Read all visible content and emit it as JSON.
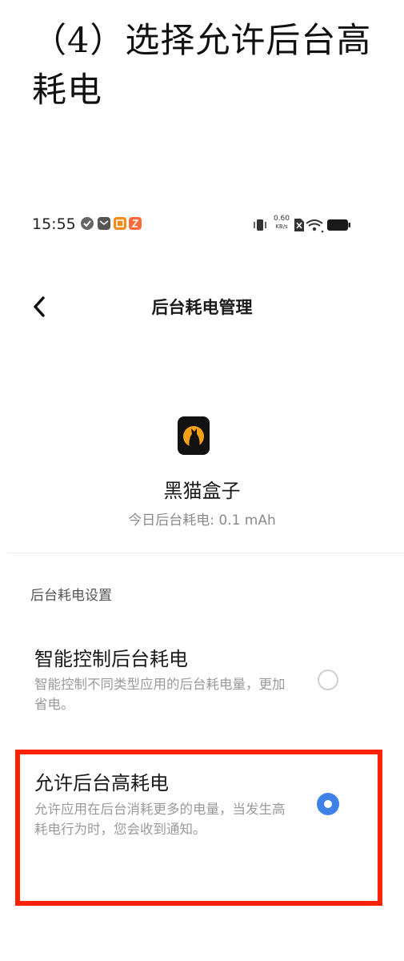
{
  "heading": "（4）选择允许后台高耗电",
  "status_bar": {
    "time": "15:55",
    "network_speed_value": "0.60",
    "network_speed_unit": "KB/s",
    "icons": [
      "check-circle-icon",
      "mail-icon",
      "app-notification-icon",
      "app-notification-icon",
      "vibrate-icon",
      "no-sim-icon",
      "wifi-icon",
      "battery-icon"
    ]
  },
  "nav": {
    "title": "后台耗电管理",
    "back_icon": "chevron-left-icon"
  },
  "app": {
    "name": "黑猫盒子",
    "usage": "今日后台耗电: 0.1 mAh",
    "icon": "black-cat-app-icon"
  },
  "section": {
    "title": "后台耗电设置"
  },
  "options": [
    {
      "title": "智能控制后台耗电",
      "desc": "智能控制不同类型应用的后台耗电量，更加省电。",
      "selected": false
    },
    {
      "title": "允许后台高耗电",
      "desc": "允许应用在后台消耗更多的电量，当发生高耗电行为时，您会收到通知。",
      "selected": true
    }
  ],
  "colors": {
    "accent": "#3e82e8",
    "highlight": "#ff2200",
    "app_icon_bg": "#121212",
    "app_icon_glow": "#f4a018"
  }
}
